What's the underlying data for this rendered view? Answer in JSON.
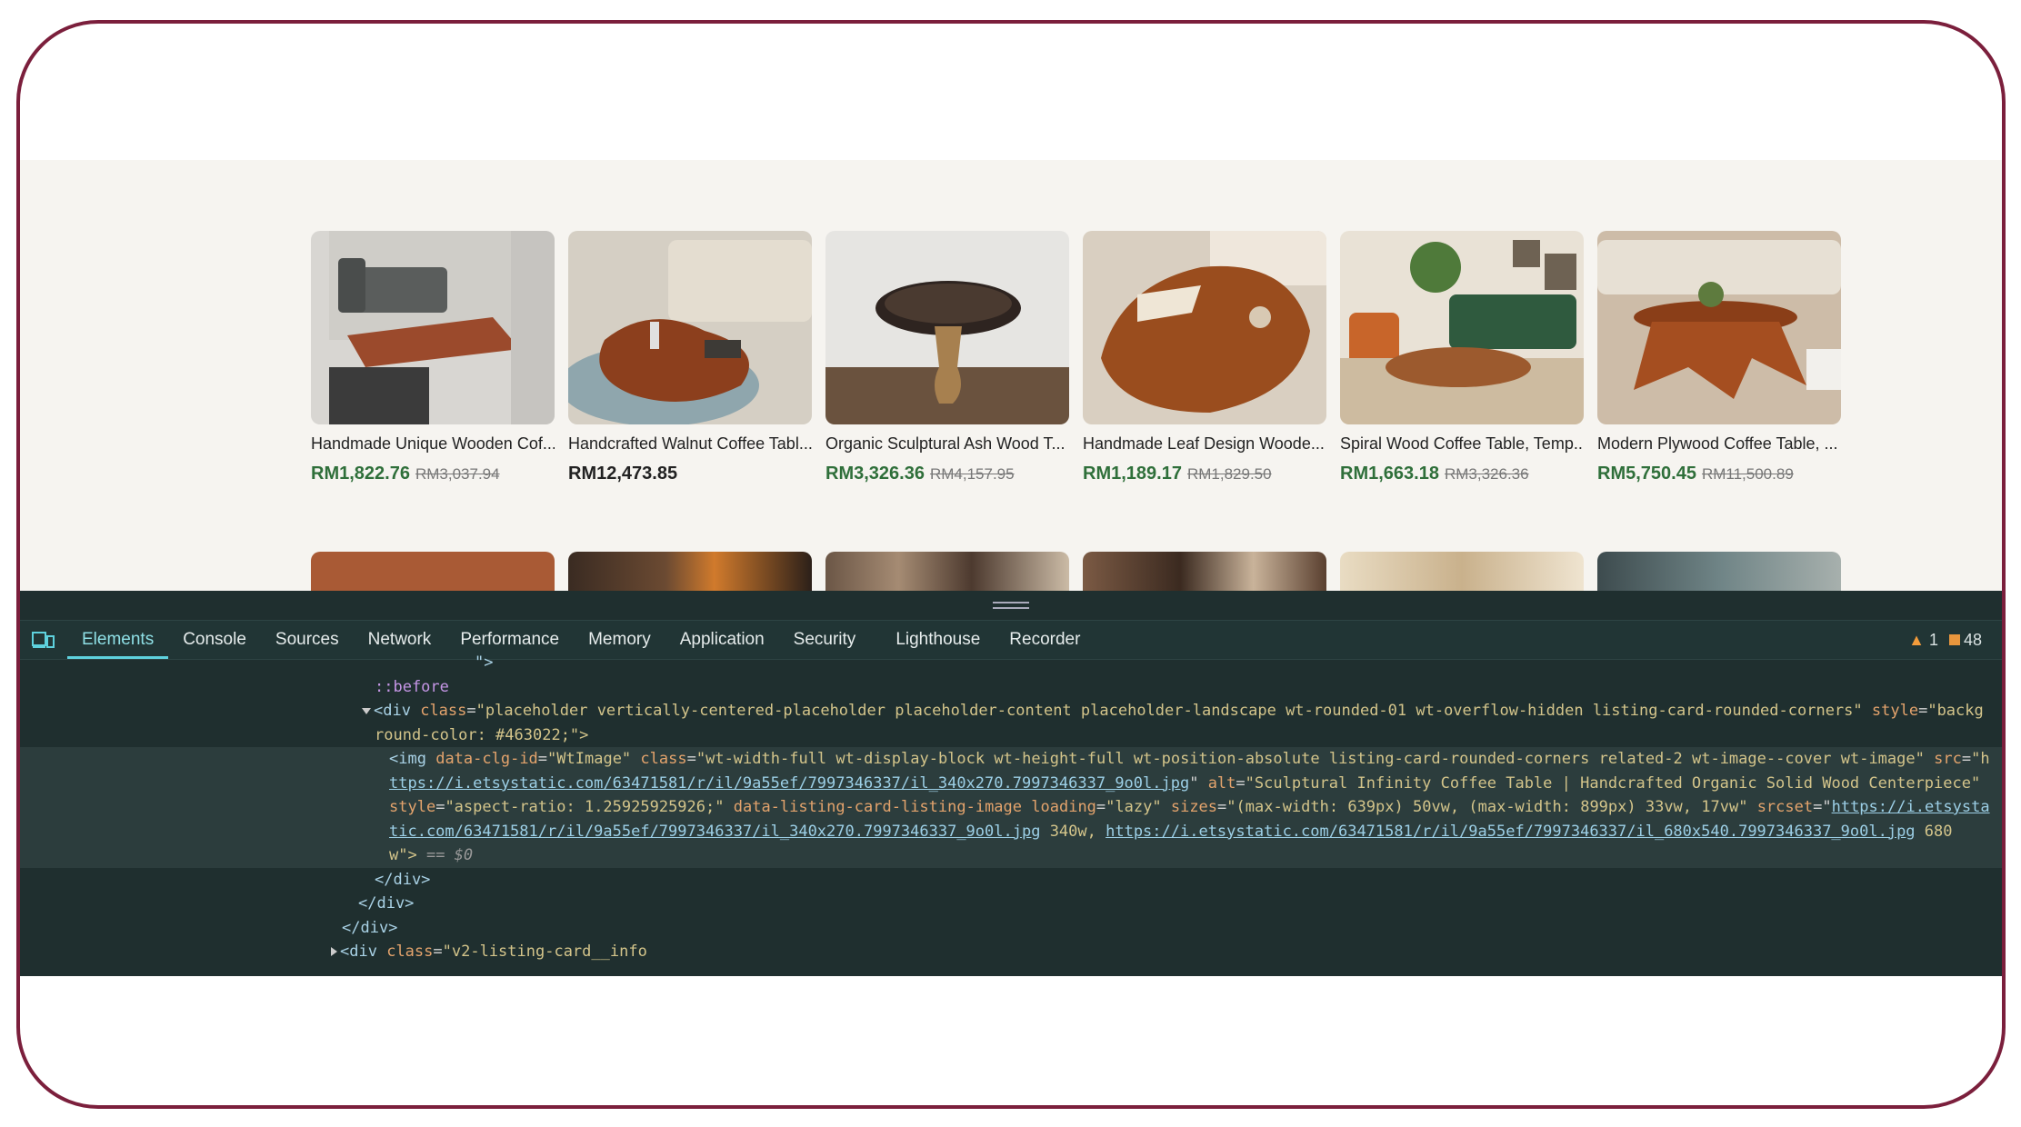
{
  "products_row1": [
    {
      "title": "Handmade Unique Wooden Cof...",
      "price": "RM1,822.76",
      "original": "RM3,037.94"
    },
    {
      "title": "Handcrafted Walnut Coffee Tabl...",
      "price": "RM12,473.85",
      "original": ""
    },
    {
      "title": "Organic Sculptural Ash Wood T...",
      "price": "RM3,326.36",
      "original": "RM4,157.95"
    },
    {
      "title": "Handmade Leaf Design Woode...",
      "price": "RM1,189.17",
      "original": "RM1,829.50"
    },
    {
      "title": "Spiral Wood Coffee Table, Temp...",
      "price": "RM1,663.18",
      "original": "RM3,326.36"
    },
    {
      "title": "Modern Plywood Coffee Table, ...",
      "price": "RM5,750.45",
      "original": "RM11,500.89"
    }
  ],
  "devtools": {
    "tabs": [
      "Elements",
      "Console",
      "Sources",
      "Network",
      "Performance",
      "Memory",
      "Application",
      "Security",
      "Lighthouse",
      "Recorder"
    ],
    "active_tab": "Elements",
    "warnings": "1",
    "errors": "48",
    "code": {
      "l0": "\">",
      "l1": "::before",
      "l2_tag": "<div",
      "l2_attr": "class",
      "l2_val": "\"placeholder vertically-centered-placeholder placeholder-content placeholder-landscape wt-rounded-01 wt-overflow-hidden listing-card-rounded-corners\"",
      "l2_attr2": "style",
      "l2_val2": "\"backg",
      "l3": "round-color: #463022;\">",
      "l4_tag": "<img",
      "l4_a1": "data-clg-id",
      "l4_v1": "\"WtImage\"",
      "l4_a2": "class",
      "l4_v2": "\"wt-width-full wt-display-block wt-height-full wt-position-absolute listing-card-rounded-corners related-2 wt-image--cover wt-image\"",
      "l4_a3": "src",
      "l4_v3": "\"h",
      "l5_link": "ttps://i.etsystatic.com/63471581/r/il/9a55ef/7997346337/il_340x270.7997346337_9o0l.jpg",
      "l5_a": "alt",
      "l5_v": "\"Sculptural Infinity Coffee Table | Handcrafted Organic Solid Wood Centerpiece\"",
      "l6_a1": "style",
      "l6_v1": "\"aspect-ratio: 1.25925925926;\"",
      "l6_a2": "data-listing-card-listing-image",
      "l6_a3": "loading",
      "l6_v3": "\"lazy\"",
      "l6_a4": "sizes",
      "l6_v4": "\"(max-width: 639px) 50vw, (max-width: 899px) 33vw, 17vw\"",
      "l6_a5": "srcset",
      "l6_link": "https://i.etsysta",
      "l7_link1": "tic.com/63471581/r/il/9a55ef/7997346337/il_340x270.7997346337_9o0l.jpg",
      "l7_mid": " 340w, ",
      "l7_link2": "https://i.etsystatic.com/63471581/r/il/9a55ef/7997346337/il_680x540.7997346337_9o0l.jpg",
      "l7_end": " 680",
      "l8": "w\">",
      "l8_eq": " == $0",
      "l9": "</div>",
      "l10": "</div>",
      "l11": "</div>",
      "l12_tag": "<div",
      "l12_attr": "class",
      "l12_val": "\"v2-listing-card__info"
    }
  }
}
